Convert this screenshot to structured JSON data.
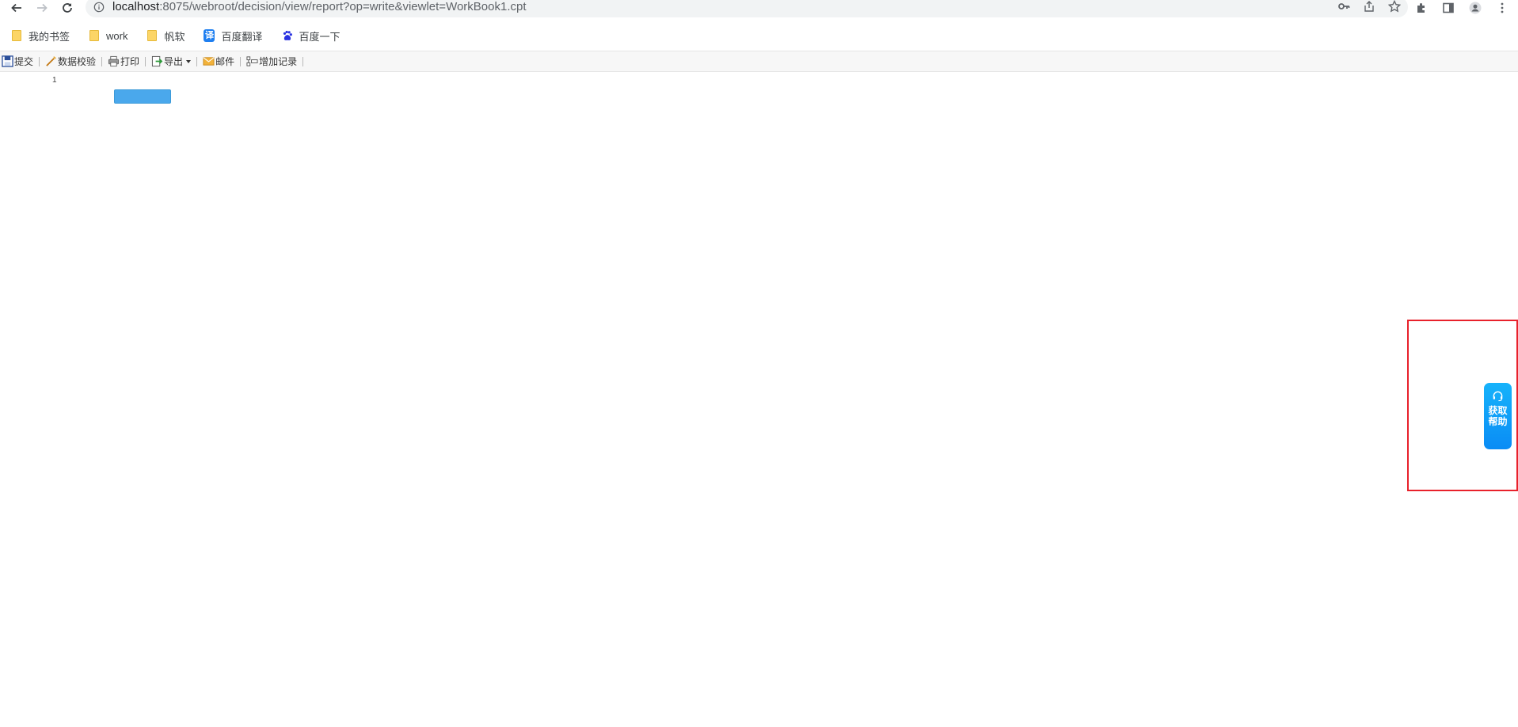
{
  "browser": {
    "url_host": "localhost",
    "url_rest": ":8075/webroot/decision/view/report?op=write&viewlet=WorkBook1.cpt",
    "icons": {
      "back": "arrow-left-icon",
      "forward": "arrow-right-icon",
      "reload": "reload-icon",
      "info": "info-icon",
      "key": "key-icon",
      "share": "share-icon",
      "star": "star-icon",
      "extensions": "puzzle-icon",
      "side_panel": "side-panel-icon",
      "profile": "profile-icon",
      "menu": "kebab-menu-icon"
    }
  },
  "bookmarks": [
    {
      "label": "我的书签",
      "icon": "folder-icon"
    },
    {
      "label": "work",
      "icon": "folder-icon"
    },
    {
      "label": "帆软",
      "icon": "folder-icon"
    },
    {
      "label": "百度翻译",
      "icon": "translate-icon"
    },
    {
      "label": "百度一下",
      "icon": "baidu-icon"
    }
  ],
  "toolbar": {
    "submit": "提交",
    "validate": "数据校验",
    "print": "打印",
    "export": "导出",
    "mail": "邮件",
    "add_record": "增加记录"
  },
  "report": {
    "row_number": "1"
  },
  "help_float": {
    "label": "获取帮助",
    "icon": "headset-icon"
  },
  "colors": {
    "accent_blue": "#4aa8ec",
    "help_gradient_top": "#16b3fb",
    "help_gradient_bottom": "#0a8cf5",
    "highlight_red": "#e8212b"
  }
}
